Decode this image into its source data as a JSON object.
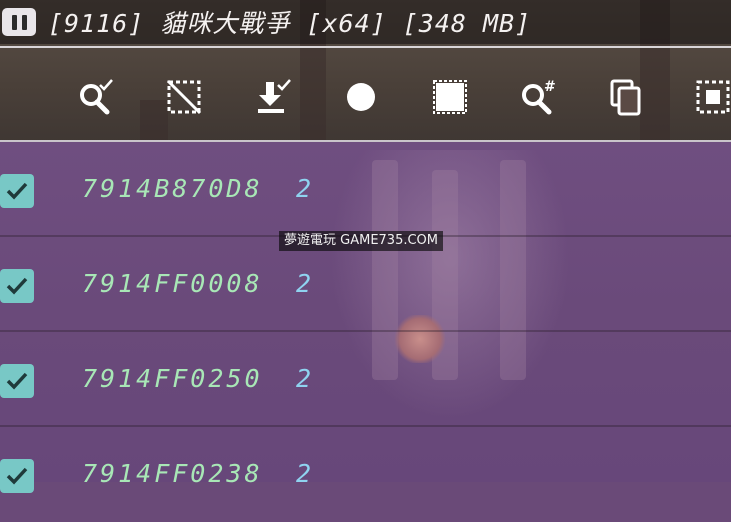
{
  "header": {
    "title": "[9116] 貓咪大戰爭 [x64] [348 MB]"
  },
  "toolbar": {
    "tools": [
      {
        "icon": "search-check-icon"
      },
      {
        "icon": "deselect-icon"
      },
      {
        "icon": "download-check-icon"
      },
      {
        "icon": "circle-icon"
      },
      {
        "icon": "select-all-icon"
      },
      {
        "icon": "search-hash-icon"
      },
      {
        "icon": "copy-icon"
      },
      {
        "icon": "select-box-icon"
      }
    ]
  },
  "results": [
    {
      "address": "7914B870D8",
      "value": "2",
      "checked": true
    },
    {
      "address": "7914FF0008",
      "value": "2",
      "checked": true
    },
    {
      "address": "7914FF0250",
      "value": "2",
      "checked": true
    },
    {
      "address": "7914FF0238",
      "value": "2",
      "checked": true
    }
  ],
  "watermark": "夢遊電玩 GAME735.COM",
  "colors": {
    "address": "#a8e7b6",
    "value": "#8fd3f0",
    "checkbox": "#78c8c6",
    "list_background": "#6a4a7a"
  }
}
